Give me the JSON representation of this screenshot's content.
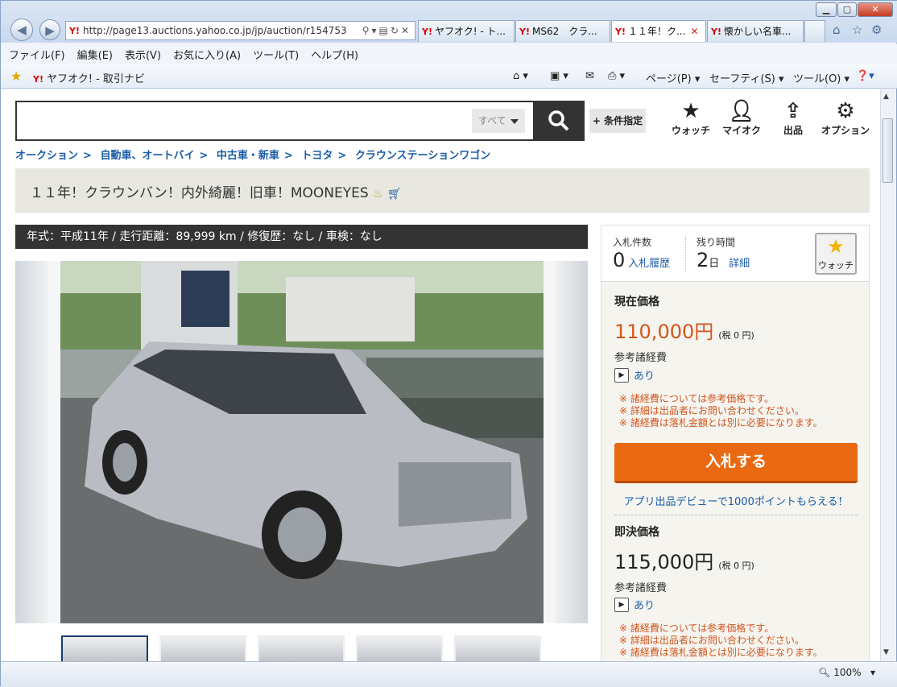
{
  "browser": {
    "url": "http://page13.auctions.yahoo.co.jp/jp/auction/r154753",
    "y_logo": "Y!",
    "tabs": [
      {
        "label": "ヤフオク! - ト..."
      },
      {
        "label": "MS62　クラ..."
      },
      {
        "label": "１１年！ク..."
      },
      {
        "label": "懐かしい名車..."
      }
    ],
    "menu": [
      "ファイル(F)",
      "編集(E)",
      "表示(V)",
      "お気に入り(A)",
      "ツール(T)",
      "ヘルプ(H)"
    ],
    "favorite_link": "ヤフオク! - 取引ナビ",
    "commands": [
      "ページ(P)",
      "セーフティ(S)",
      "ツール(O)"
    ],
    "zoom": "100%"
  },
  "page": {
    "search_scope": "すべて",
    "condition_button": "+ 条件指定",
    "icon_buttons": [
      {
        "label": "ウォッチ"
      },
      {
        "label": "マイオク"
      },
      {
        "label": "出品"
      },
      {
        "label": "オプション"
      }
    ],
    "breadcrumbs": [
      "オークション",
      "自動車、オートバイ",
      "中古車・新車",
      "トヨタ",
      "クラウンステーションワゴン"
    ],
    "breadcrumb_sep": ">",
    "title": "１１年！クラウンバン！内外綺麗！旧車！MOONEYES",
    "info": "年式：平成11年 / 走行距離：89,999 km / 修復歴：なし / 車検：なし"
  },
  "panel": {
    "bids_label": "入札件数",
    "bids_count": "0",
    "bid_history": "入札履歴",
    "remain_label": "残り時間",
    "remain_value": "2",
    "remain_unit": "日",
    "detail_link": "詳細",
    "watch_label": "ウォッチ",
    "current_label": "現在価格",
    "current_price": "110,000円",
    "current_tax": "(税 0 円)",
    "fees_label": "参考諸経費",
    "fees_value": "あり",
    "notes": [
      "※ 諸経費については参考価格です。",
      "※ 詳細は出品者にお問い合わせください。",
      "※ 諸経費は落札金額とは別に必要になります。"
    ],
    "bid_button": "入札する",
    "promo": "アプリ出品デビューで1000ポイントもらえる！",
    "buyout_label": "即決価格",
    "buyout_price": "115,000円",
    "buyout_tax": "(税 0 円)",
    "buyout_fees_label": "参考諸経費",
    "buyout_fees_value": "あり",
    "price_color": "#d4551d"
  }
}
